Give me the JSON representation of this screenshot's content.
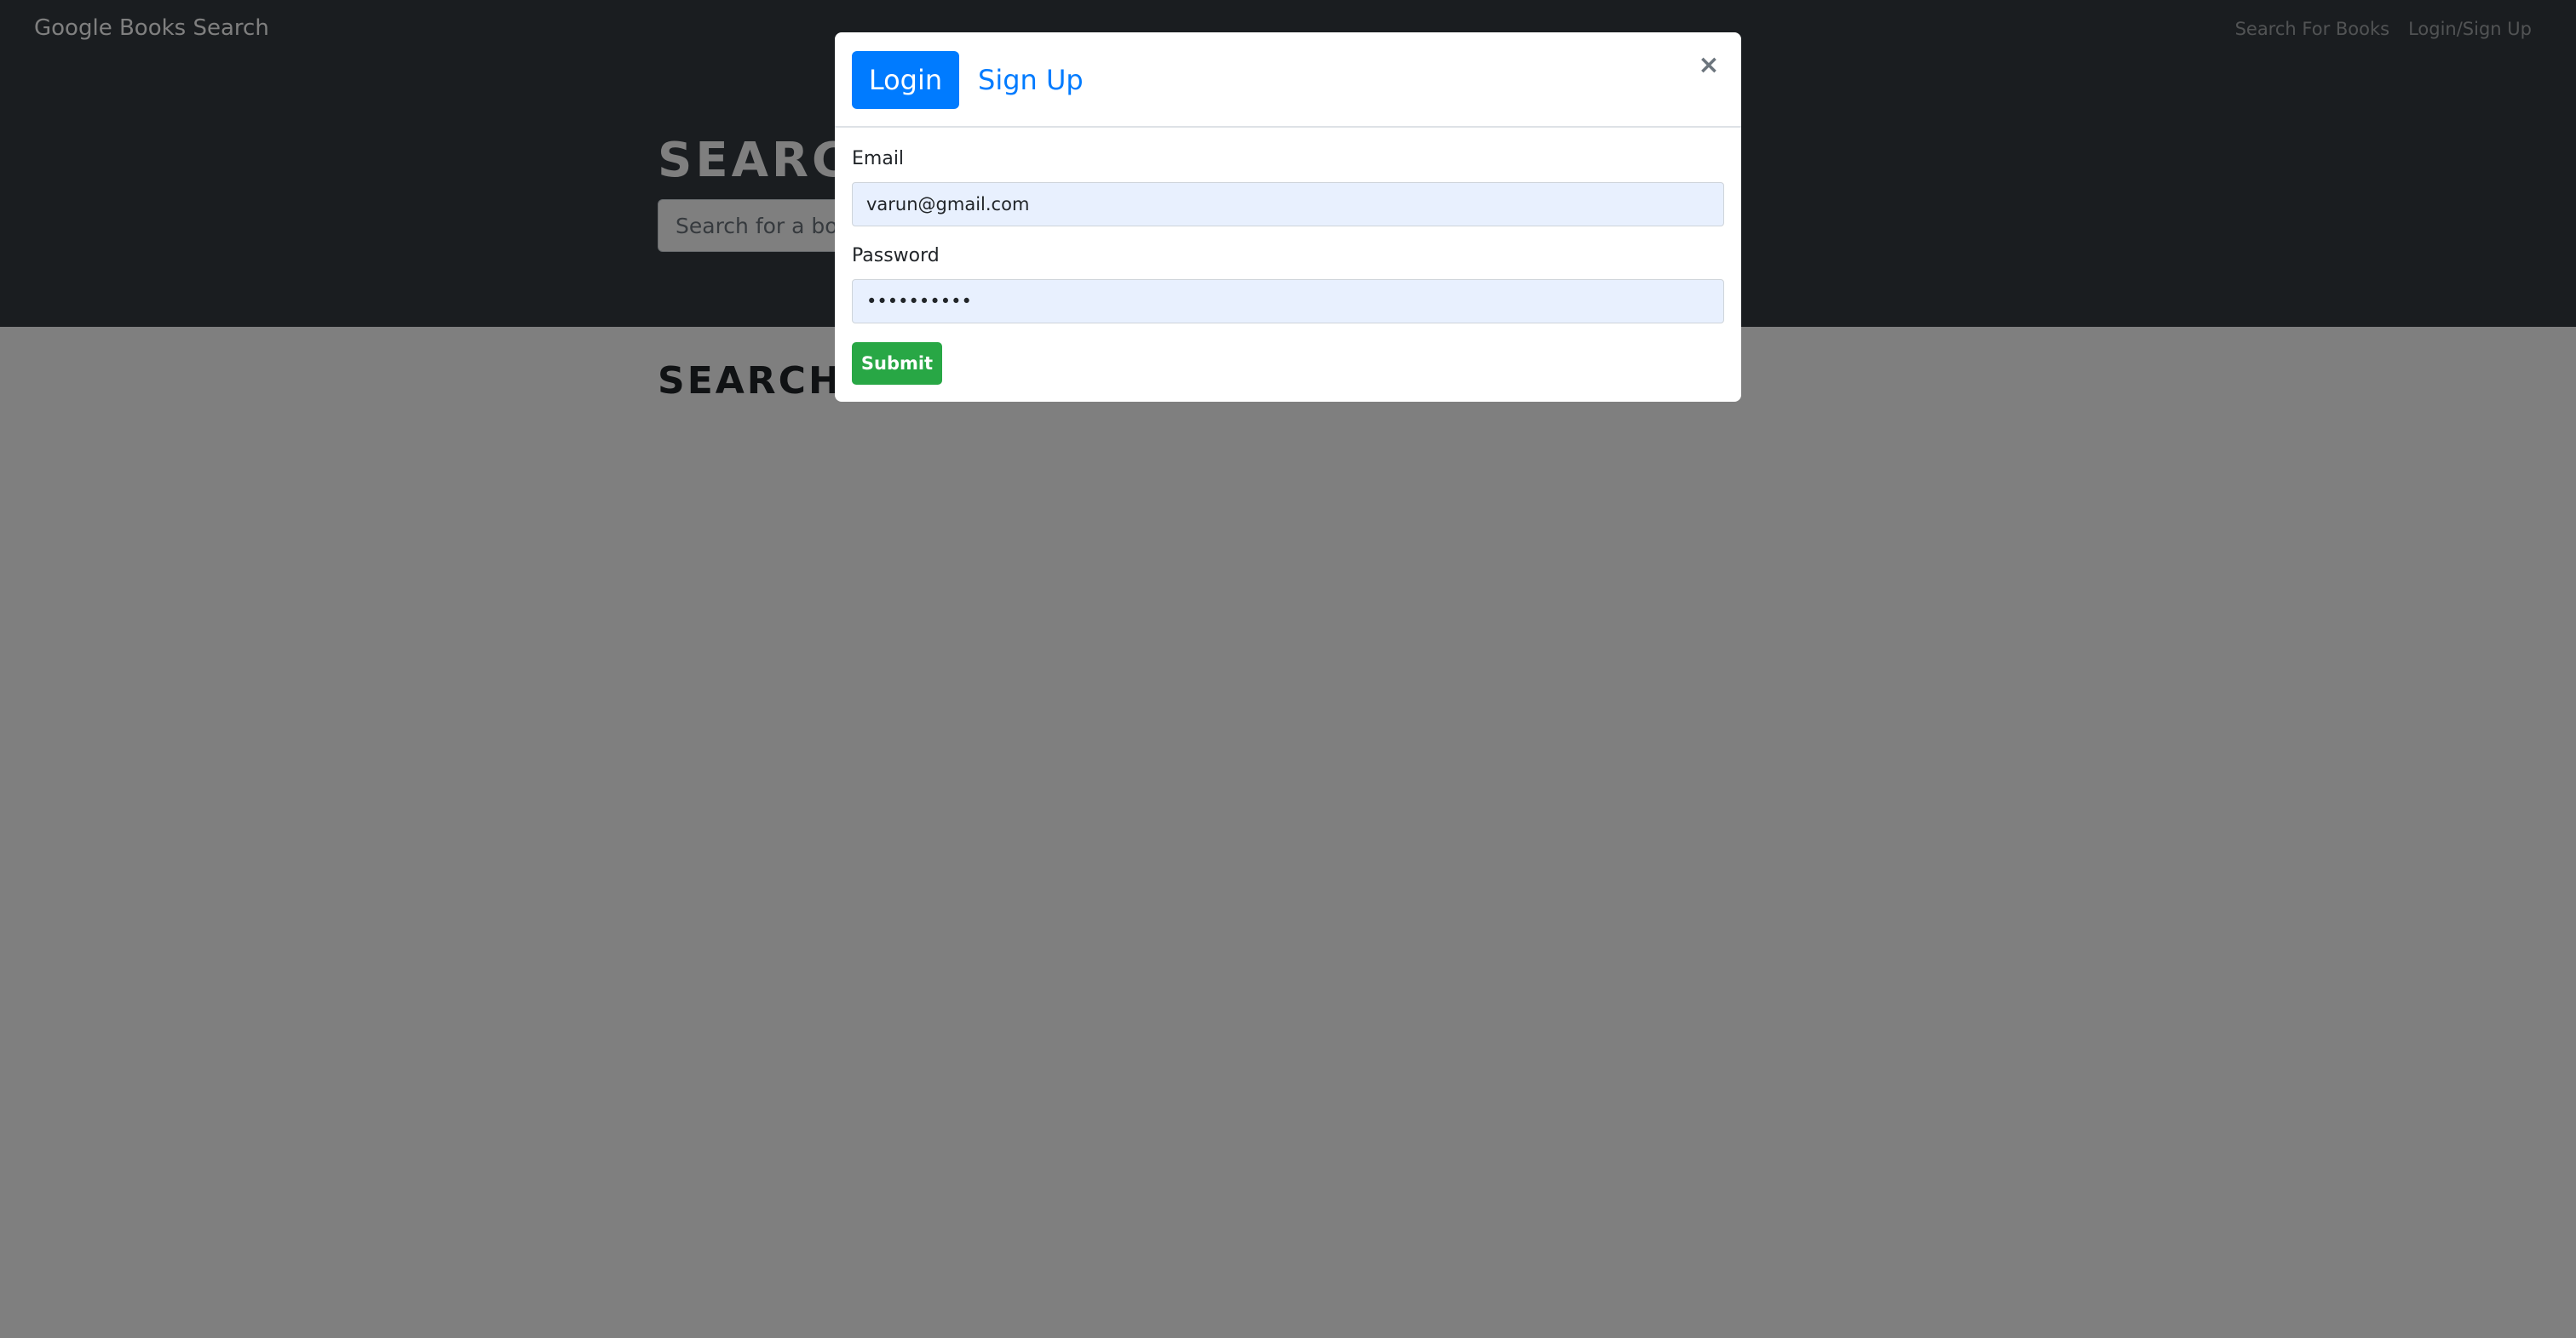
{
  "navbar": {
    "brand": "Google Books Search",
    "links": [
      "Search For Books",
      "Login/Sign Up"
    ]
  },
  "hero": {
    "title": "SEARCH FOR BOOKS!",
    "search_placeholder": "Search for a book"
  },
  "results": {
    "title": "SEARCH FOR A BOOK TO BEGIN"
  },
  "modal": {
    "tabs": [
      "Login",
      "Sign Up"
    ],
    "active_tab": "Login",
    "close_glyph": "×",
    "email_label": "Email",
    "email_value": "varun@gmail.com",
    "password_label": "Password",
    "password_value": "••••••••••",
    "submit_label": "Submit"
  },
  "colors": {
    "navbar_bg": "#343a40",
    "primary": "#007bff",
    "success": "#28a745",
    "autofill_bg": "#e8f0fe",
    "backdrop": "rgba(0,0,0,0.5)"
  }
}
